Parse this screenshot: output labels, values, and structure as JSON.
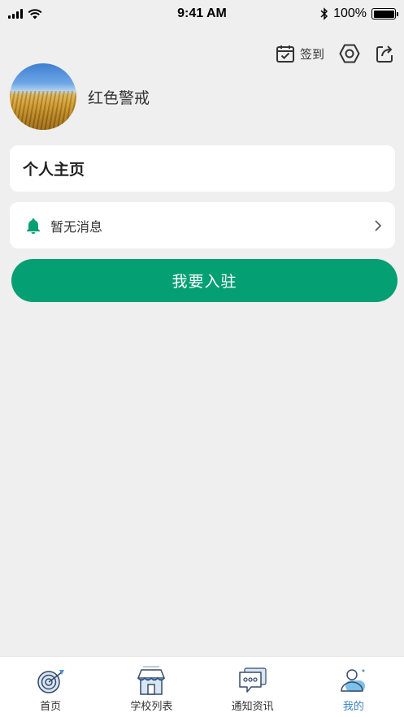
{
  "status_bar": {
    "time": "9:41 AM",
    "battery": "100%",
    "icons": [
      "signal-icon",
      "wifi-icon",
      "bluetooth-icon",
      "battery-icon"
    ]
  },
  "header": {
    "checkin_label": "签到",
    "icons": [
      "calendar-check-icon",
      "settings-icon",
      "share-icon"
    ]
  },
  "profile": {
    "username": "红色警戒"
  },
  "homepage_card": {
    "label": "个人主页"
  },
  "message_card": {
    "text": "暂无消息",
    "icons": [
      "bell-icon",
      "chevron-right-icon"
    ]
  },
  "join_button": {
    "label": "我要入驻"
  },
  "tabbar": {
    "items": [
      {
        "label": "首页",
        "icon": "target-icon",
        "active": false
      },
      {
        "label": "学校列表",
        "icon": "store-icon",
        "active": false
      },
      {
        "label": "通知资讯",
        "icon": "chat-icon",
        "active": false
      },
      {
        "label": "我的",
        "icon": "user-icon",
        "active": true
      }
    ]
  },
  "colors": {
    "accent": "#059f74",
    "background": "#efefef",
    "active_tab": "#3a82c9"
  }
}
